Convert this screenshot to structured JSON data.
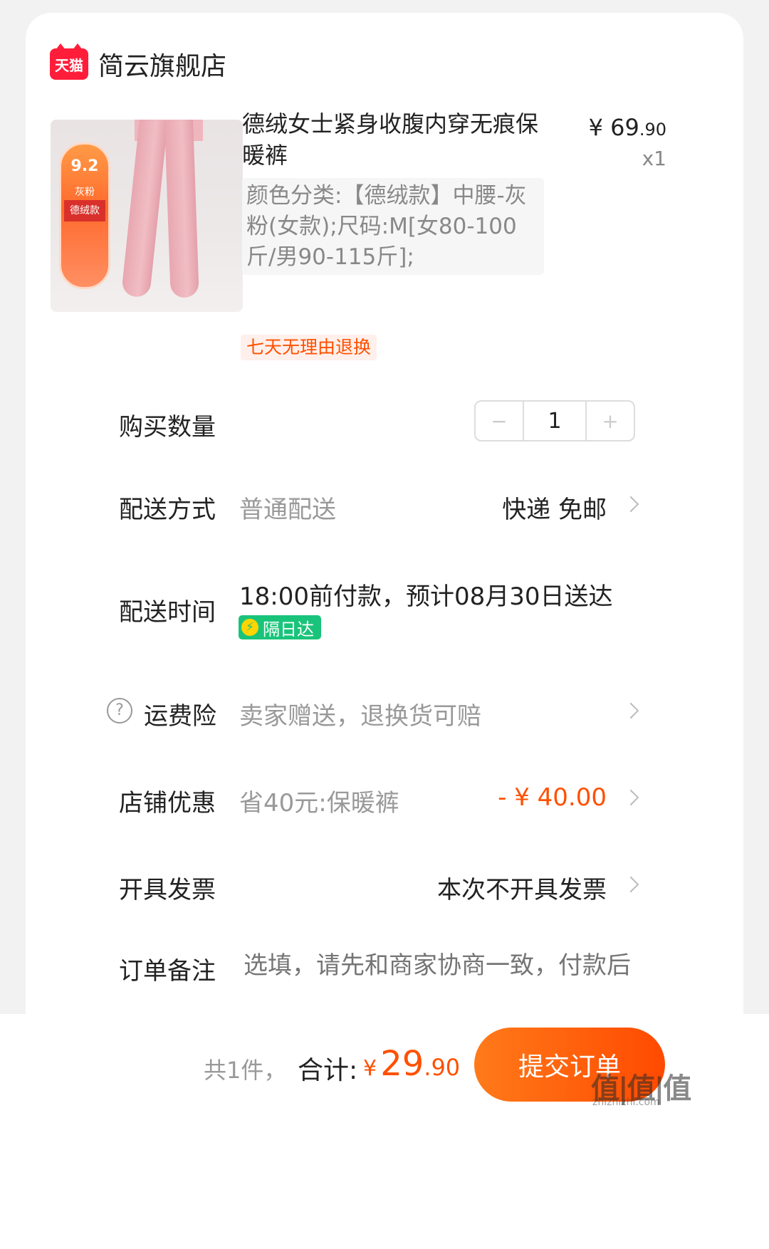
{
  "shop": {
    "logo_text": "天猫",
    "name": "简云旗舰店"
  },
  "product": {
    "image_badge": {
      "score": "9.2",
      "color": "灰粉",
      "style": "德绒款"
    },
    "title": "德绒女士紧身收腹内穿无痕保暖裤",
    "price_symbol": "¥",
    "price_int": "69",
    "price_dec": ".90",
    "quantity_text": "x1",
    "sku": "颜色分类:【德绒款】中腰-灰粉(女款);尺码:M[女80-100斤/男90-115斤];",
    "promise_tag": "七天无理由退换"
  },
  "rows": {
    "quantity": {
      "label": "购买数量",
      "value": "1",
      "minus": "−",
      "plus": "+"
    },
    "delivery": {
      "label": "配送方式",
      "type": "普通配送",
      "value": "快递 免邮"
    },
    "delivery_time": {
      "label": "配送时间",
      "value": "18:00前付款，预计08月30日送达",
      "tag": "隔日达"
    },
    "shipping_insurance": {
      "label": "运费险",
      "value": "卖家赠送，退换货可赔"
    },
    "store_discount": {
      "label": "店铺优惠",
      "desc": "省40元:保暖裤",
      "value": "- ¥ 40.00"
    },
    "invoice": {
      "label": "开具发票",
      "value": "本次不开具发票"
    },
    "note": {
      "label": "订单备注",
      "placeholder": "选填，请先和商家协商一致，付款后"
    }
  },
  "footer": {
    "count": "共1件，",
    "total_label": "合计:",
    "total_symbol": "¥",
    "total_int": "29",
    "total_dec": ".90",
    "submit_label": "提交订单"
  },
  "watermark": {
    "text": "值|值|值",
    "sub": "zhizhizhi.com"
  },
  "colors": {
    "accent": "#ff5000",
    "tmall_red": "#ff1d3a",
    "nextday_green": "#19c47a"
  }
}
